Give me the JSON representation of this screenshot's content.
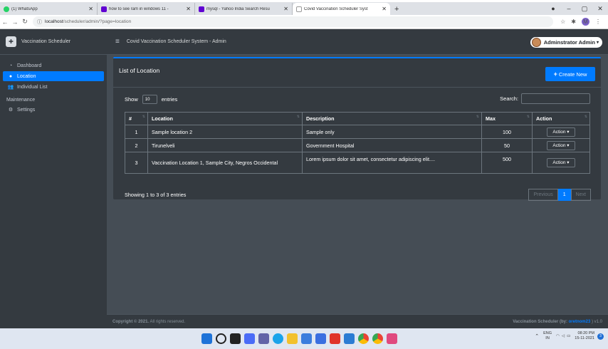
{
  "browser": {
    "tabs": [
      {
        "title": "(1) WhatsApp",
        "color": "#25d366",
        "active": false
      },
      {
        "title": "how to see ram in windows 11 -",
        "color": "#6001d2",
        "active": false
      },
      {
        "title": "mysql - Yahoo India Search Resu",
        "color": "#6001d2",
        "active": false
      },
      {
        "title": "Covid Vaccination Scheduler Syst",
        "color": "#ffffff",
        "active": true
      }
    ],
    "url_host": "localhost",
    "url_path": "/scheduler/admin/?page=location",
    "profile_initial": "M"
  },
  "sidebar": {
    "brand": "Vaccination Scheduler",
    "items": [
      {
        "label": "Dashboard",
        "icon": "dashboard-icon",
        "active": false
      },
      {
        "label": "Location",
        "icon": "map-marker-icon",
        "active": true
      },
      {
        "label": "Individual List",
        "icon": "users-icon",
        "active": false
      }
    ],
    "section_header": "Maintenance",
    "maintenance_items": [
      {
        "label": "Settings",
        "icon": "settings-icon",
        "active": false
      }
    ]
  },
  "header": {
    "title": "Covid Vaccination Scheduler System - Admin",
    "user": "Adminstrator Admin"
  },
  "card": {
    "title": "List of Location",
    "create_label": "Create New"
  },
  "table_controls": {
    "show": "Show",
    "length": "10",
    "entries": "entries",
    "search": "Search:"
  },
  "table": {
    "columns": [
      "#",
      "Location",
      "Description",
      "Max",
      "Action"
    ],
    "rows": [
      {
        "num": "1",
        "location": "Sample location 2",
        "description": "Sample only",
        "max": "100",
        "action": "Action"
      },
      {
        "num": "2",
        "location": "Tirunelveli",
        "description": "Government Hospital",
        "max": "50",
        "action": "Action"
      },
      {
        "num": "3",
        "location": "Vaccination Location 1, Sample City, Negros Occidental",
        "description": "Lorem ipsum dolor sit amet, consectetur adipiscing elit....",
        "max": "500",
        "action": "Action"
      }
    ]
  },
  "pagination": {
    "info": "Showing 1 to 3 of 3 entries",
    "previous": "Previous",
    "current": "1",
    "next": "Next"
  },
  "footer": {
    "copyright_bold": "Copyright © 2021.",
    "copyright_rest": " All rights reserved.",
    "right_text": "Vaccination Scheduler (by: ",
    "right_link": "oretnom23",
    "right_version": " ) v1.0"
  },
  "taskbar": {
    "lang_top": "ENG",
    "lang_bottom": "IN",
    "time": "08:20 PM",
    "date": "15-11-2021",
    "notifications": "3"
  },
  "colors": {
    "accent": "#007bff",
    "sidebar_bg": "#343a40",
    "content_bg": "#454d55"
  }
}
